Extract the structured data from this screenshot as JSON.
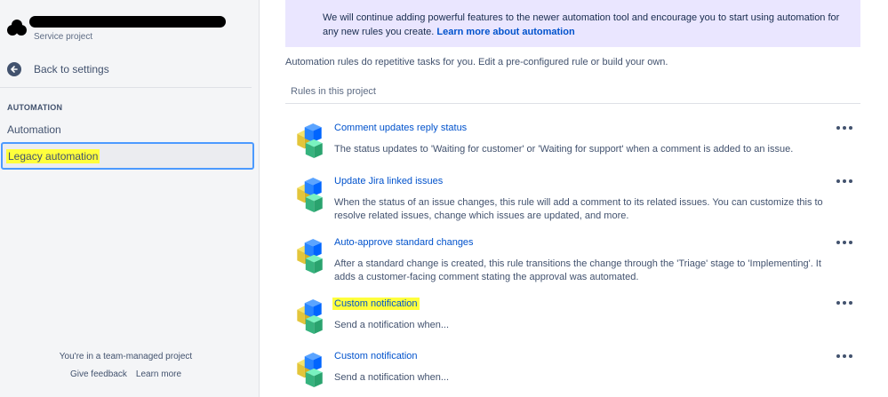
{
  "sidebar": {
    "project_type": "Service project",
    "back_label": "Back to settings",
    "section_heading": "AUTOMATION",
    "items": [
      {
        "label": "Automation"
      },
      {
        "label": "Legacy automation"
      }
    ],
    "footer_text": "You're in a team-managed project",
    "footer_links": [
      "Give feedback",
      "Learn more"
    ]
  },
  "banner": {
    "text": "We will continue adding powerful features to the newer automation tool and encourage you to start using automation for any new rules you create.",
    "link": "Learn more about automation"
  },
  "main": {
    "intro": "Automation rules do repetitive tasks for you. Edit a pre-configured rule or build your own.",
    "rules_heading": "Rules in this project",
    "rules": [
      {
        "title": "Comment updates reply status",
        "description": "The status updates to 'Waiting for customer' or 'Waiting for support' when a comment is added to an issue."
      },
      {
        "title": "Update Jira linked issues",
        "description": "When the status of an issue changes, this rule will add a comment to its related issues. You can customize this to resolve related issues, change which issues are updated, and more."
      },
      {
        "title": "Auto-approve standard changes",
        "description": "After a standard change is created, this rule transitions the change through the 'Triage' stage to 'Implementing'. It adds a customer-facing comment stating the approval was automated."
      },
      {
        "title": "Custom notification",
        "description": "Send a notification when..."
      },
      {
        "title": "Custom notification",
        "description": "Send a notification when..."
      }
    ]
  },
  "colors": {
    "accent": "#0052cc",
    "highlight": "#ffff3c",
    "banner_bg": "#eae6ff",
    "sidebar_bg": "#f4f5f7"
  },
  "icons": [
    "back-arrow-icon",
    "automation-cubes-icon",
    "more-actions-icon"
  ]
}
